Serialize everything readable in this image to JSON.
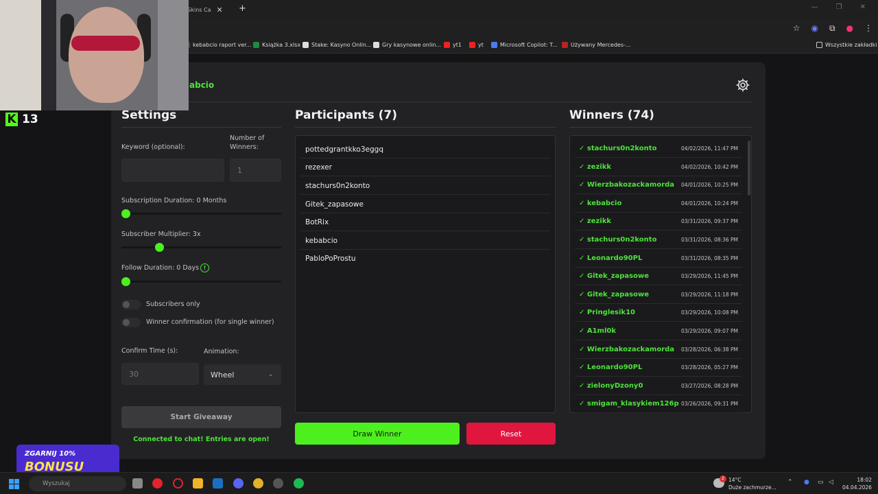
{
  "browser": {
    "tab_title": "G4Skins Ca",
    "new_tab": "+",
    "bookmarks": [
      {
        "label": "kebabcio raport ver..."
      },
      {
        "label": "Książka 3.xlsx"
      },
      {
        "label": "Stake: Kasyno Onlin..."
      },
      {
        "label": "Gry kasynowe onlin..."
      },
      {
        "label": "yt1"
      },
      {
        "label": "yt"
      },
      {
        "label": "Microsoft Copilot: T..."
      },
      {
        "label": "Używany Mercedes-..."
      }
    ],
    "all_bookmarks": "Wszystkie zakładki"
  },
  "app": {
    "brand": "abcio",
    "settings": {
      "title": "Settings",
      "keyword_label": "Keyword (optional):",
      "keyword_value": "",
      "winners_label": "Number of Winners:",
      "winners_value": "1",
      "sub_duration_label": "Subscription Duration: 0 Months",
      "sub_duration_value": 0,
      "multiplier_label": "Subscriber Multiplier: 3x",
      "multiplier_value": 3,
      "follow_label": "Follow Duration:  0  Days",
      "follow_value": 0,
      "subs_only_label": "Subscribers only",
      "subs_only": false,
      "confirm_label": "Winner confirmation (for single winner)",
      "confirm": false,
      "confirm_time_label": "Confirm Time (s):",
      "confirm_time_placeholder": "30",
      "animation_label": "Animation:",
      "animation_value": "Wheel",
      "start_button": "Start Giveaway",
      "status": "Connected to chat! Entries are open!"
    },
    "participants": {
      "title": "Participants (7)",
      "items": [
        "pottedgrantkko3eggq",
        "rezexer",
        "stachurs0n2konto",
        "Gitek_zapasowe",
        "BotRix",
        "kebabcio",
        "PabloPoProstu"
      ],
      "draw_button": "Draw Winner",
      "reset_button": "Reset"
    },
    "winners": {
      "title": "Winners (74)",
      "items": [
        {
          "name": "✓ stachurs0n2konto",
          "date": "04/02/2026, 11:47 PM"
        },
        {
          "name": "✓ zezikk",
          "date": "04/02/2026, 10:42 PM"
        },
        {
          "name": "✓ Wierzbakozackamorda",
          "date": "04/01/2026, 10:25 PM"
        },
        {
          "name": "✓ kebabcio",
          "date": "04/01/2026, 10:24 PM"
        },
        {
          "name": "✓ zezikk",
          "date": "03/31/2026, 09:37 PM"
        },
        {
          "name": "✓ stachurs0n2konto",
          "date": "03/31/2026, 08:36 PM"
        },
        {
          "name": "✓ Leonardo90PL",
          "date": "03/31/2026, 08:35 PM"
        },
        {
          "name": "✓ Gitek_zapasowe",
          "date": "03/29/2026, 11:45 PM"
        },
        {
          "name": "✓ Gitek_zapasowe",
          "date": "03/29/2026, 11:18 PM"
        },
        {
          "name": "✓ Pringlesik10",
          "date": "03/29/2026, 10:08 PM"
        },
        {
          "name": "✓ A1ml0k",
          "date": "03/29/2026, 09:07 PM"
        },
        {
          "name": "✓ Wierzbakozackamorda",
          "date": "03/28/2026, 06:38 PM"
        },
        {
          "name": "✓ Leonardo90PL",
          "date": "03/28/2026, 05:27 PM"
        },
        {
          "name": "✓ zielonyDzony0",
          "date": "03/27/2026, 08:28 PM"
        },
        {
          "name": "✓ smigam_klasykiem126p",
          "date": "03/26/2026, 09:31 PM"
        }
      ]
    }
  },
  "overlay": {
    "kick_count": "13",
    "promo_line1": "ZGARNIJ 10%",
    "promo_line2": "BONUSU"
  },
  "taskbar": {
    "search": "Wyszukaj",
    "weather_temp": "14°C",
    "weather_desc": "Duże zachmurze...",
    "weather_badge": "2",
    "time": "18:02",
    "date": "04.04.2026"
  },
  "colors": {
    "accent": "#4df01f",
    "winner_text": "#4de33a",
    "reset": "#e0163f",
    "panel": "#222224"
  }
}
